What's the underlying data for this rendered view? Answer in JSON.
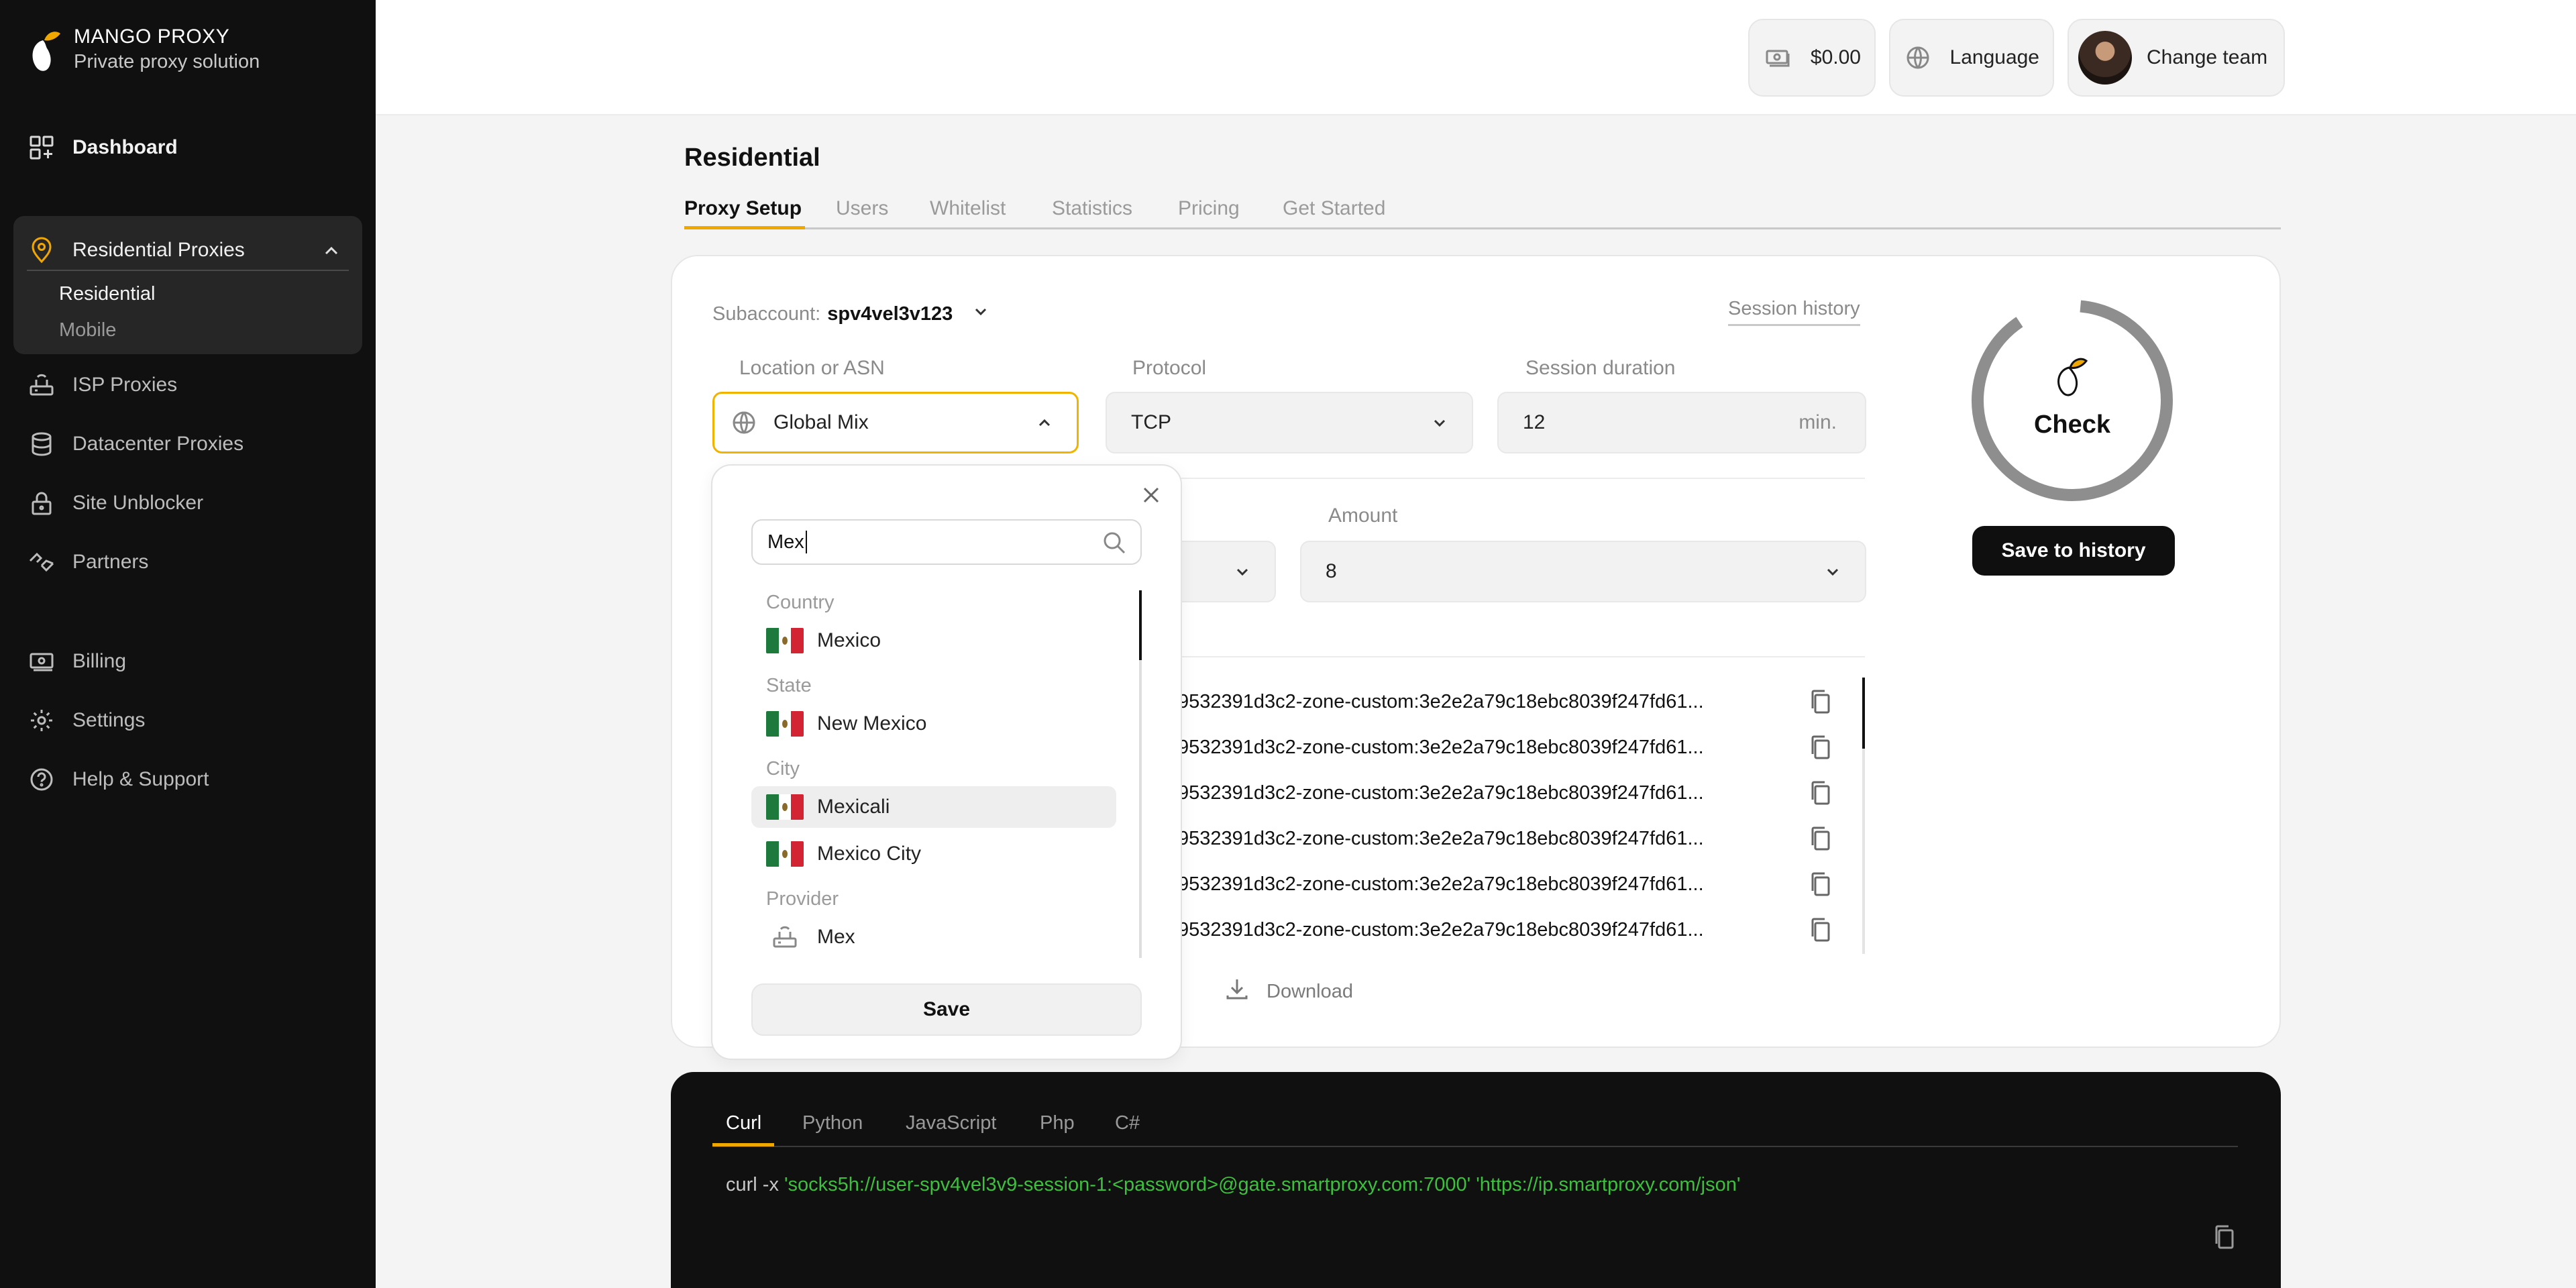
{
  "brand": {
    "name": "MANGO PROXY",
    "tagline": "Private proxy solution",
    "accent": "#f0a800"
  },
  "sidebar": {
    "dashboard": "Dashboard",
    "residential_group": "Residential Proxies",
    "residential_sub": [
      "Residential",
      "Mobile"
    ],
    "items": [
      {
        "label": "ISP Proxies",
        "icon": "router-icon"
      },
      {
        "label": "Datacenter Proxies",
        "icon": "database-icon"
      },
      {
        "label": "Site Unblocker",
        "icon": "lock-icon"
      },
      {
        "label": "Partners",
        "icon": "handshake-icon"
      }
    ],
    "bottom_items": [
      {
        "label": "Billing",
        "icon": "cash-icon"
      },
      {
        "label": "Settings",
        "icon": "gear-icon"
      },
      {
        "label": "Help & Support",
        "icon": "help-icon"
      }
    ]
  },
  "topbar": {
    "balance": "$0.00",
    "language": "Language",
    "team": "Change team"
  },
  "page": {
    "title": "Residential",
    "tabs": [
      "Proxy Setup",
      "Users",
      "Whitelist",
      "Statistics",
      "Pricing",
      "Get Started"
    ]
  },
  "setup": {
    "subaccount_label": "Subaccount:",
    "subaccount_value": "spv4vel3v123",
    "session_history": "Session history",
    "location_label": "Location or ASN",
    "location_value": "Global Mix",
    "protocol_label": "Protocol",
    "protocol_value": "TCP",
    "duration_label": "Session duration",
    "duration_value": "12",
    "duration_unit": "min.",
    "amount_label": "Amount",
    "amount_value": "8",
    "proxy_lines": [
      "9532391d3c2-zone-custom:3e2e2a79c18ebc8039f247fd61...",
      "9532391d3c2-zone-custom:3e2e2a79c18ebc8039f247fd61...",
      "9532391d3c2-zone-custom:3e2e2a79c18ebc8039f247fd61...",
      "9532391d3c2-zone-custom:3e2e2a79c18ebc8039f247fd61...",
      "9532391d3c2-zone-custom:3e2e2a79c18ebc8039f247fd61...",
      "9532391d3c2-zone-custom:3e2e2a79c18ebc8039f247fd61..."
    ],
    "download": "Download",
    "check": "Check",
    "save_history": "Save to history"
  },
  "dropdown": {
    "search_value": "Mex",
    "groups": {
      "country": "Country",
      "state": "State",
      "city": "City",
      "provider": "Provider"
    },
    "country_items": [
      "Mexico"
    ],
    "state_items": [
      "New Mexico"
    ],
    "city_items": [
      "Mexicali",
      "Mexico City"
    ],
    "provider_items": [
      "Mex"
    ],
    "save": "Save"
  },
  "code": {
    "tabs": [
      "Curl",
      "Python",
      "JavaScript",
      "Php",
      "C#"
    ],
    "prefix": "curl -x ",
    "command": "'socks5h://user-spv4vel3v9-session-1:<password>@gate.smartproxy.com:7000' 'https://ip.smartproxy.com/json'"
  }
}
